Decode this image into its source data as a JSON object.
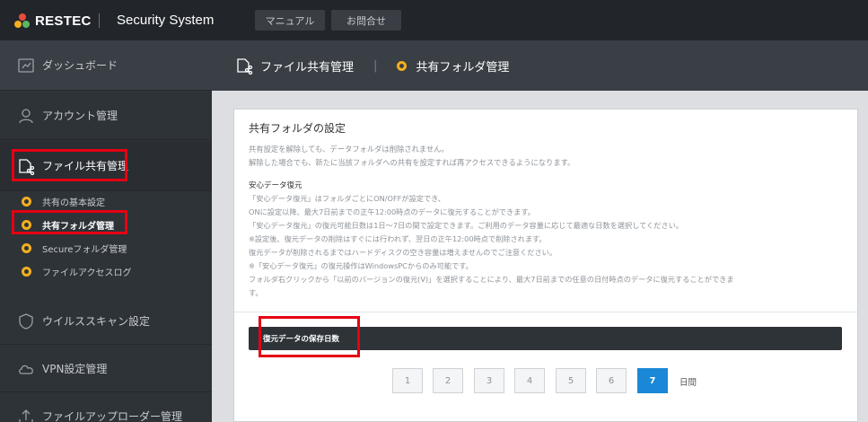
{
  "header": {
    "brand": "RESTEC",
    "app_title": "Security System",
    "buttons": {
      "manual": "マニュアル",
      "contact": "お問合せ"
    }
  },
  "sidebar": {
    "items": [
      {
        "label": "ダッシュボード",
        "icon": "dashboard-icon"
      },
      {
        "label": "アカウント管理",
        "icon": "user-icon"
      },
      {
        "label": "ファイル共有管理",
        "icon": "file-share-icon"
      },
      {
        "label": "ウイルススキャン設定",
        "icon": "shield-icon"
      },
      {
        "label": "VPN設定管理",
        "icon": "cloud-icon"
      },
      {
        "label": "ファイルアップローダー管理",
        "icon": "upload-icon"
      }
    ],
    "sub_items": [
      {
        "label": "共有の基本設定"
      },
      {
        "label": "共有フォルダ管理"
      },
      {
        "label": "Secureフォルダ管理"
      },
      {
        "label": "ファイルアクセスログ"
      }
    ],
    "accent_color": "#f2b01e",
    "highlight_color": "#e60012"
  },
  "page_header": {
    "section": "ファイル共有管理",
    "current": "共有フォルダ管理"
  },
  "card": {
    "title": "共有フォルダの設定",
    "notes": [
      "共有設定を解除しても、データフォルダは削除されません。",
      "解除した場合でも、新たに当該フォルダへの共有を設定すれば再アクセスできるようになります。"
    ],
    "backup_heading": "安心データ復元",
    "backup_lines": [
      "「安心データ復元」はフォルダごとにON/OFFが設定でき、",
      "ONに設定以降、最大7日前までの正午12:00時点のデータに復元することができます。",
      "「安心データ復元」の復元可能日数は1日〜7日の間で設定できます。ご利用のデータ容量に応じて最適な日数を選択してください。",
      "※設定後、復元データの削除はすぐには行われず、翌日の正午12:00時点で削除されます。",
      "復元データが削除されるまではハードディスクの空き容量は増えませんのでご注意ください。",
      "※「安心データ復元」の復元操作はWindowsPCからのみ可能です。",
      "フォルダ右クリックから「以前のバージョンの復元(V)」を選択することにより、最大7日前までの任意の日付時点のデータに復元することができま",
      "す。"
    ],
    "retention_label": "復元データの保存日数",
    "day_options": [
      "1",
      "2",
      "3",
      "4",
      "5",
      "6",
      "7"
    ],
    "selected_day": "7",
    "day_unit": "日間",
    "selected_color": "#1a88d6"
  }
}
